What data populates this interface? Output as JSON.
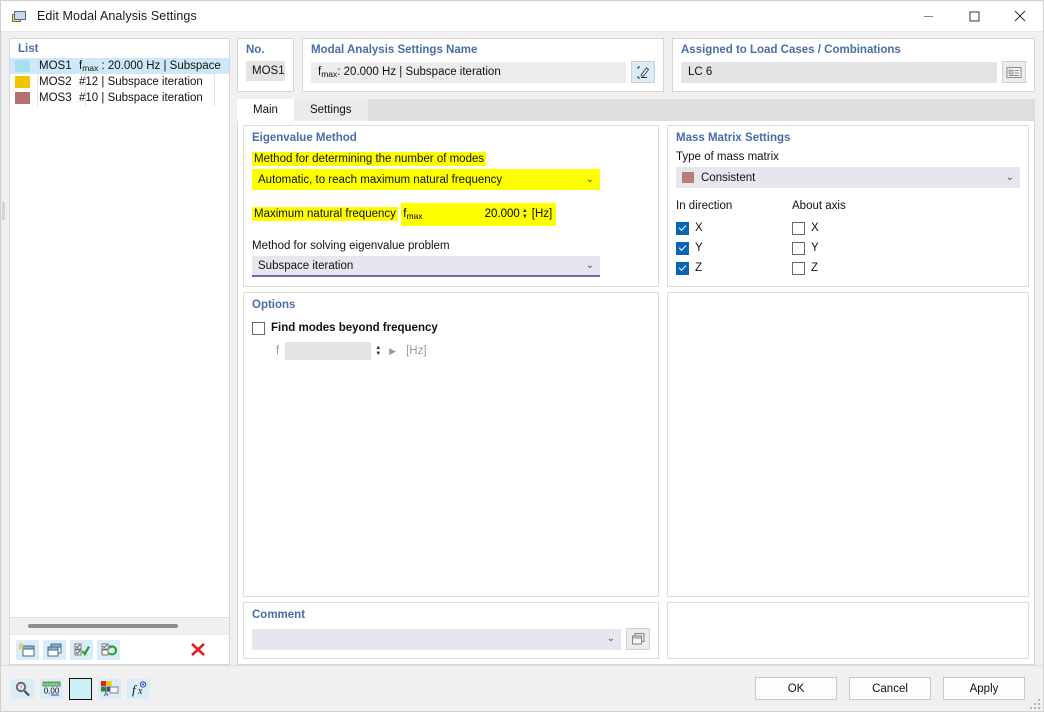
{
  "window": {
    "title": "Edit Modal Analysis Settings",
    "icon": "modal-analysis-icon",
    "minimize": "–",
    "maximize": "□",
    "close": "✕"
  },
  "list_panel": {
    "header": "List",
    "rows": [
      {
        "swatch": "#a6dff2",
        "name": "MOS1",
        "desc_pre": "f",
        "desc_sub": "max",
        "desc": " : 20.000 Hz | Subspace",
        "selected": true
      },
      {
        "swatch": "#f5c400",
        "name": "MOS2",
        "desc_pre": "",
        "desc_sub": "",
        "desc": "#12 | Subspace iteration",
        "selected": false
      },
      {
        "swatch": "#b5706e",
        "name": "MOS3",
        "desc_pre": "",
        "desc_sub": "",
        "desc": "#10 | Subspace iteration",
        "selected": false
      }
    ],
    "toolbar": [
      {
        "name": "new-item-button",
        "glyph": "new"
      },
      {
        "name": "copy-item-button",
        "glyph": "copy"
      },
      {
        "name": "select-all-button",
        "glyph": "check"
      },
      {
        "name": "invert-selection-button",
        "glyph": "invert"
      },
      {
        "name": "delete-item-button",
        "glyph": "delete"
      }
    ]
  },
  "no_panel": {
    "title": "No.",
    "value": "MOS1"
  },
  "name_panel": {
    "title": "Modal Analysis Settings Name",
    "value_pre": "f",
    "value_sub": "max",
    "value": " : 20.000 Hz | Subspace iteration",
    "edit_button": "edit-name-icon"
  },
  "assigned_panel": {
    "title": "Assigned to Load Cases / Combinations",
    "value": "LC 6",
    "picker_button": "load-case-picker-icon"
  },
  "tabs": [
    {
      "label": "Main",
      "active": true
    },
    {
      "label": "Settings",
      "active": false
    }
  ],
  "eigenvalue": {
    "title": "Eigenvalue Method",
    "method_modes_label": "Method for determining the number of modes",
    "method_modes_value": "Automatic, to reach maximum natural frequency",
    "max_freq_label": "Maximum natural frequency",
    "fmax_symbol_pre": "f",
    "fmax_symbol_sub": "max",
    "fmax_value": "20.000",
    "fmax_unit": "[Hz]",
    "solve_label": "Method for solving eigenvalue problem",
    "solve_value": "Subspace iteration"
  },
  "mass_matrix": {
    "title": "Mass Matrix Settings",
    "type_label": "Type of mass matrix",
    "type_value": "Consistent",
    "type_swatch": "#bd7a78",
    "in_direction_label": "In direction",
    "about_axis_label": "About axis",
    "in_direction": [
      {
        "label": "X",
        "checked": true
      },
      {
        "label": "Y",
        "checked": true
      },
      {
        "label": "Z",
        "checked": true
      }
    ],
    "about_axis": [
      {
        "label": "X",
        "checked": false
      },
      {
        "label": "Y",
        "checked": false
      },
      {
        "label": "Z",
        "checked": false
      }
    ]
  },
  "options": {
    "title": "Options",
    "find_modes_label": "Find modes beyond frequency",
    "find_modes_checked": false,
    "f_label": "f",
    "f_value": "",
    "f_unit": "[Hz]"
  },
  "comment": {
    "title": "Comment",
    "value": "",
    "button": "comment-library-icon"
  },
  "footer": {
    "tools": [
      {
        "name": "search-tool-button",
        "glyph": "magnifier"
      },
      {
        "name": "units-tool-button",
        "glyph": "units"
      },
      {
        "name": "color-tool-button",
        "glyph": "color"
      },
      {
        "name": "display-properties-button",
        "glyph": "display"
      },
      {
        "name": "formula-tool-button",
        "glyph": "formula"
      }
    ],
    "ok": "OK",
    "cancel": "Cancel",
    "apply": "Apply"
  },
  "colors": {
    "accent": "#4a6da7",
    "highlight": "#ffff00",
    "selection": "#cde8f7",
    "checkbox": "#0a64b4"
  }
}
